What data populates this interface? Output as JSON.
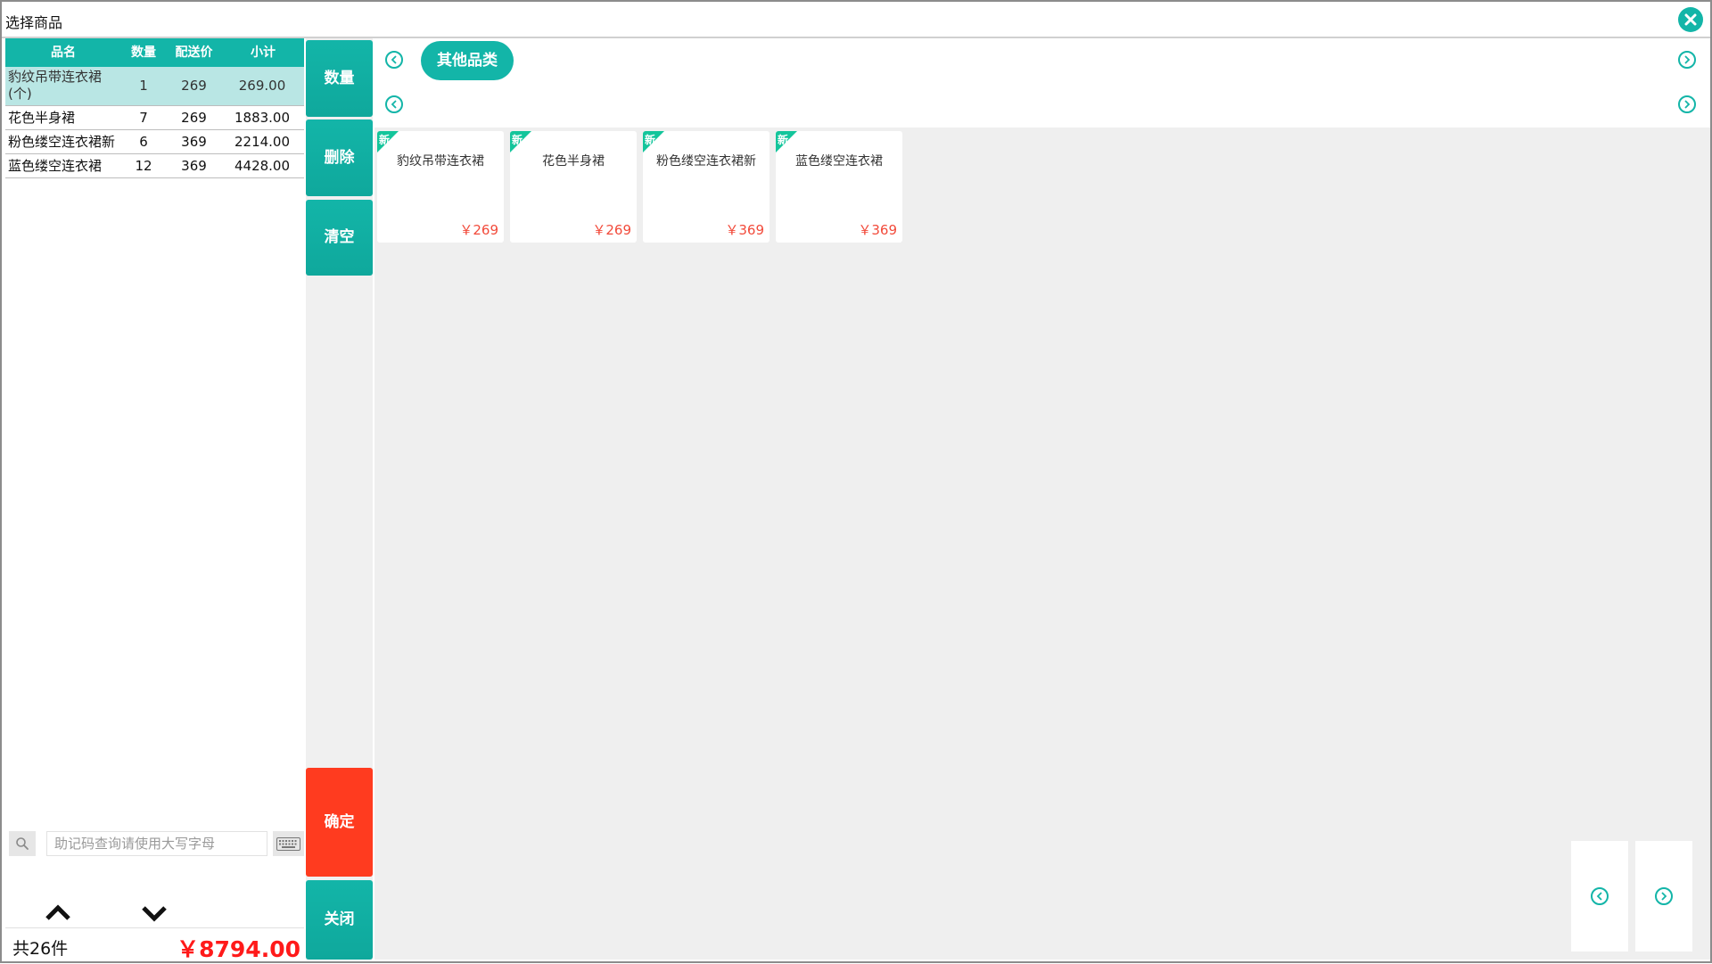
{
  "window": {
    "title": "选择商品"
  },
  "order_table": {
    "headers": [
      "品名",
      "数量",
      "配送价",
      "小计"
    ],
    "rows": [
      {
        "name": "豹纹吊带连衣裙(个)",
        "qty": "1",
        "price": "269",
        "subtotal": "269.00"
      },
      {
        "name": "花色半身裙",
        "qty": "7",
        "price": "269",
        "subtotal": "1883.00"
      },
      {
        "name": "粉色缕空连衣裙新",
        "qty": "6",
        "price": "369",
        "subtotal": "2214.00"
      },
      {
        "name": "蓝色缕空连衣裙",
        "qty": "12",
        "price": "369",
        "subtotal": "4428.00"
      }
    ]
  },
  "search": {
    "placeholder": "助记码查询请使用大写字母"
  },
  "summary": {
    "count": "共26件",
    "total": "￥8794.00"
  },
  "actions": {
    "quantity": "数量",
    "delete": "删除",
    "clear": "清空",
    "confirm": "确定",
    "close": "关闭"
  },
  "categories": {
    "active": "其他品类"
  },
  "products": [
    {
      "tag": "新",
      "name": "豹纹吊带连衣裙",
      "price": "￥269"
    },
    {
      "tag": "新",
      "name": "花色半身裙",
      "price": "￥269"
    },
    {
      "tag": "新",
      "name": "粉色缕空连衣裙新",
      "price": "￥369"
    },
    {
      "tag": "新",
      "name": "蓝色缕空连衣裙",
      "price": "￥369"
    }
  ],
  "colors": {
    "accent": "#13b5a8",
    "confirm": "#ff3b1f",
    "price": "#f24a3a",
    "total": "#ff1a1a",
    "selected_row": "#b9e6e4",
    "new_tag": "#13c59b"
  },
  "icons": [
    "close-icon",
    "search-icon",
    "keyboard-icon",
    "chevron-up-icon",
    "chevron-down-icon",
    "chevron-left-icon",
    "chevron-right-icon"
  ]
}
